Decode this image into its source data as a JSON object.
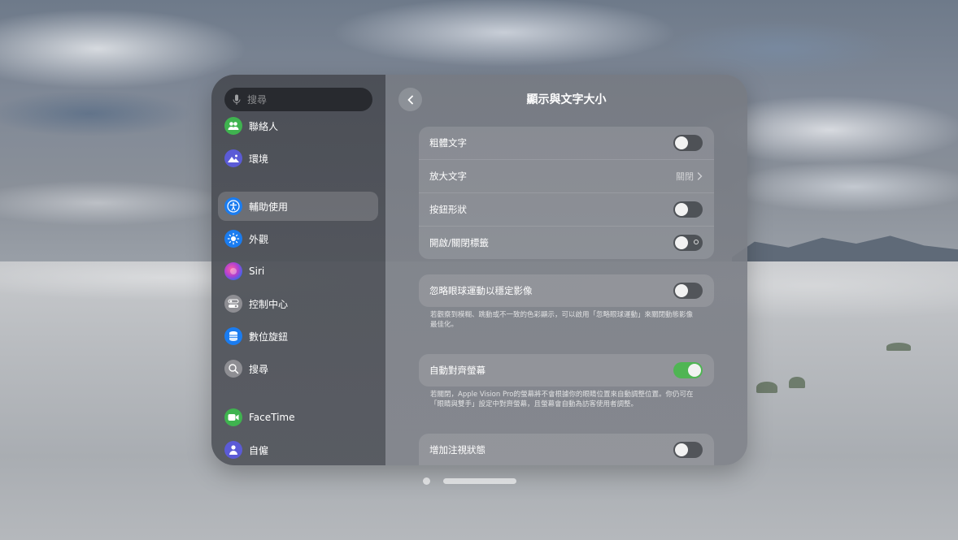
{
  "sidebar": {
    "search_placeholder": "搜尋",
    "items": [
      {
        "label": "聯絡人",
        "icon": "contacts-icon",
        "color": "#3fb34f"
      },
      {
        "label": "環境",
        "icon": "environment-icon",
        "color": "#5b5bd6"
      },
      {
        "label": "輔助使用",
        "icon": "accessibility-icon",
        "color": "#1a7cf0",
        "active": true
      },
      {
        "label": "外觀",
        "icon": "appearance-icon",
        "color": "#1a7cf0"
      },
      {
        "label": "Siri",
        "icon": "siri-icon",
        "color": "#b040d0"
      },
      {
        "label": "控制中心",
        "icon": "control-center-icon",
        "color": "#8e8e93"
      },
      {
        "label": "數位旋鈕",
        "icon": "digital-crown-icon",
        "color": "#1a7cf0"
      },
      {
        "label": "搜尋",
        "icon": "search-icon",
        "color": "#8e8e93"
      },
      {
        "label": "FaceTime",
        "icon": "facetime-icon",
        "color": "#3fb34f"
      },
      {
        "label": "自僱",
        "icon": "persona-icon",
        "color": "#5b5bd6"
      }
    ]
  },
  "main": {
    "title": "顯示與文字大小",
    "group1": {
      "bold_text": "粗體文字",
      "larger_text": "放大文字",
      "larger_text_value": "關閉",
      "button_shapes": "按鈕形狀",
      "on_off_labels": "開啟/關閉標籤"
    },
    "group2": {
      "ignore_eye_movements": "忽略眼球運動以穩定影像",
      "ignore_eye_movements_note": "若觀察到模糊、跳動或不一致的色彩顯示，可以啟用「忽略眼球運動」來關閉動態影像最佳化。"
    },
    "group3": {
      "auto_align_display": "自動對齊螢幕",
      "auto_align_note": "若關閉，Apple Vision Pro的螢幕將不會根據你的眼睛位置來自動調整位置。你仍可在「眼睛與雙手」設定中對齊螢幕，且螢幕會自動為訪客使用者調整。"
    },
    "group4": {
      "increase_focus_state": "增加注視狀態"
    }
  },
  "toggles": {
    "bold_text": false,
    "button_shapes": false,
    "on_off_labels": false,
    "ignore_eye_movements": false,
    "auto_align_display": true,
    "increase_focus_state": false
  },
  "colors": {
    "toggle_on": "#4fb553",
    "accent_blue": "#1a7cf0"
  }
}
